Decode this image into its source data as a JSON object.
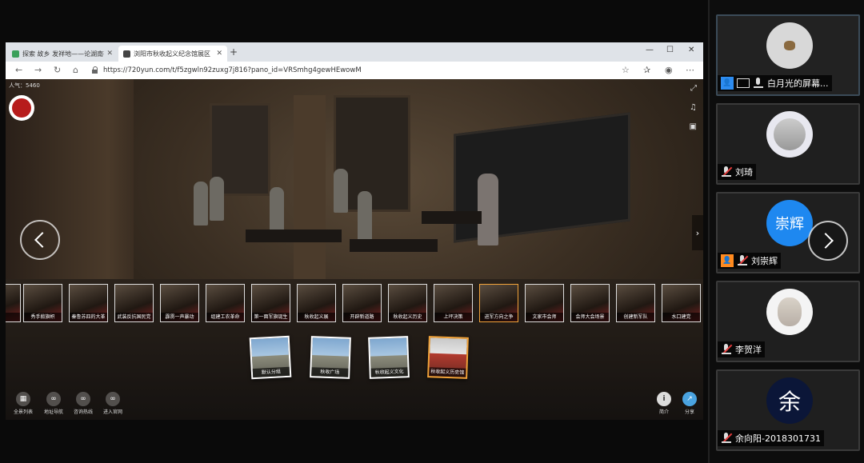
{
  "browser": {
    "tabs": [
      {
        "label": "探索 故乡 发祥地——论湖南在中国",
        "active": false
      },
      {
        "label": "浏阳市秋收起义纪念馆展区",
        "active": true
      }
    ],
    "new_tab": "+",
    "window_controls": {
      "minimize": "—",
      "maximize": "☐",
      "close": "✕"
    },
    "url": "https://720yun.com/t/f5zgwln92zuxg7j816?pano_id=VRSmhg4gewHEwowM"
  },
  "pano": {
    "popularity": "人气：5460",
    "thumbnails": [
      {
        "label": ""
      },
      {
        "label": "秀手掀旗帜"
      },
      {
        "label": "秦鲁苏四的大革"
      },
      {
        "label": "武装反抗国民党"
      },
      {
        "label": "霹雳一声暴动"
      },
      {
        "label": "组建工农革命"
      },
      {
        "label": "第一面军旗诞生"
      },
      {
        "label": "秋收起义展"
      },
      {
        "label": "开辟新道路"
      },
      {
        "label": "秋收起义历史"
      },
      {
        "label": "上坪决策"
      },
      {
        "label": "进军方向之争",
        "selected": true
      },
      {
        "label": "文家市会师"
      },
      {
        "label": "会师大会场景"
      },
      {
        "label": "创建新军队"
      },
      {
        "label": "水口建党"
      }
    ],
    "scenes": [
      {
        "label": "默认分组"
      },
      {
        "label": "秋收广场"
      },
      {
        "label": "秋收起义文化"
      },
      {
        "label": "秋收起义历史馆",
        "selected": true
      }
    ],
    "bottom_left_buttons": [
      {
        "label": "全景列表",
        "icon": "grid-icon"
      },
      {
        "label": "地址导航",
        "icon": "link-icon"
      },
      {
        "label": "咨询热线",
        "icon": "link-icon"
      },
      {
        "label": "进入官网",
        "icon": "link-icon"
      }
    ],
    "bottom_right_buttons": [
      {
        "label": "简介",
        "icon": "info-icon"
      },
      {
        "label": "分享",
        "icon": "share-icon"
      }
    ]
  },
  "participants": [
    {
      "name": "白月光的屏幕...",
      "avatar_text": "",
      "muted": false,
      "host": true,
      "sharing": true
    },
    {
      "name": "刘琦",
      "avatar_text": "",
      "muted": true
    },
    {
      "name": "刘崇辉",
      "avatar_text": "崇辉",
      "avatar_color": "#1e88f0",
      "muted": true,
      "cohost": true
    },
    {
      "name": "李贺洋",
      "avatar_text": "",
      "muted": true
    },
    {
      "name": "余向阳-2018301731",
      "avatar_text": "余",
      "avatar_color": "#0b1638",
      "muted": true
    }
  ]
}
